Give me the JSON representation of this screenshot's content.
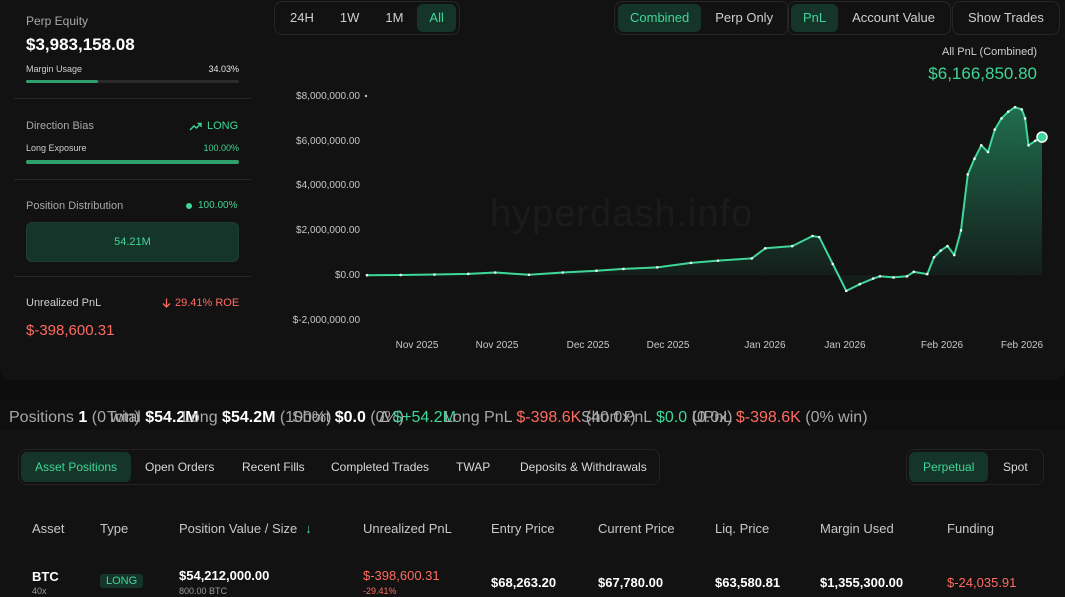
{
  "summary": {
    "perp_equity_label": "Perp Equity",
    "perp_equity_value": "$3,983,158.08",
    "margin_usage_label": "Margin Usage",
    "margin_usage_value": "34.03%",
    "margin_usage_fraction": 0.3403,
    "direction_bias_label": "Direction Bias",
    "direction_bias_value": "LONG",
    "long_exposure_label": "Long Exposure",
    "long_exposure_value": "100.00%",
    "long_exposure_fraction": 1.0,
    "position_distribution_label": "Position Distribution",
    "position_distribution_value": "100.00%",
    "distribution_bar_value": "54.21M",
    "unrealized_pnl_label": "Unrealized PnL",
    "unrealized_pnl_roe": "29.41% ROE",
    "unrealized_pnl_value": "$-398,600.31"
  },
  "range_buttons": [
    "24H",
    "1W",
    "1M",
    "All"
  ],
  "range_active": "All",
  "scope_buttons": [
    "Combined",
    "Perp Only"
  ],
  "metric_buttons": [
    "PnL",
    "Account Value"
  ],
  "show_trades_label": "Show Trades",
  "chart_header": {
    "label": "All PnL (Combined)",
    "value": "$6,166,850.80"
  },
  "watermark": "hyperdash.info",
  "chart_data": {
    "type": "area",
    "title": "All PnL (Combined)",
    "y_ticks": [
      "$8,000,000.00",
      "$6,000,000.00",
      "$4,000,000.00",
      "$2,000,000.00",
      "$0.00",
      "$-2,000,000.00"
    ],
    "y_tick_values": [
      8000000,
      6000000,
      4000000,
      2000000,
      0,
      -2000000
    ],
    "x_ticks": [
      "Nov 2025",
      "Nov 2025",
      "Dec 2025",
      "Dec 2025",
      "Jan 2026",
      "Jan 2026",
      "Feb 2026",
      "Feb 2026"
    ],
    "x_range": [
      0,
      100
    ],
    "ylim": [
      -2000000,
      8000000
    ],
    "series": [
      {
        "color": "#3fd699",
        "x": [
          0,
          5,
          10,
          15,
          19,
          24,
          29,
          34,
          38,
          43,
          48,
          52,
          57,
          59,
          63,
          66,
          67,
          69,
          71,
          73,
          75,
          76,
          78,
          80,
          81,
          83,
          84,
          85,
          86,
          87,
          88,
          89,
          90,
          91,
          92,
          93,
          94,
          95,
          96,
          97,
          97.5,
          98,
          99,
          100
        ],
        "y": [
          0,
          10000,
          30000,
          60000,
          120000,
          20000,
          120000,
          200000,
          280000,
          350000,
          550000,
          650000,
          750000,
          1200000,
          1300000,
          1750000,
          1700000,
          500000,
          -700000,
          -400000,
          -150000,
          -50000,
          -100000,
          -50000,
          150000,
          50000,
          800000,
          1100000,
          1300000,
          900000,
          2000000,
          4500000,
          5200000,
          5800000,
          5500000,
          6500000,
          7000000,
          7300000,
          7500000,
          7400000,
          7000000,
          5800000,
          6000000,
          6166850.8
        ]
      }
    ],
    "grid": false,
    "legend": "none"
  },
  "stats_strip": {
    "positions_label": "Positions",
    "positions_value": "1",
    "positions_sub": "(0 win)",
    "total_label": "Total",
    "total_value": "$54.2M",
    "long_label": "Long",
    "long_value": "$54.2M",
    "long_sub": "(100%)",
    "short_label": "Short",
    "short_value": "$0.0",
    "short_sub": "(0%)",
    "delta_label": "Δ",
    "delta_value": "$+54.2M",
    "long_pnl_label": "Long PnL",
    "long_pnl_value": "$-398.6K",
    "long_pnl_sub": "(40.0x)",
    "short_pnl_label": "Short PnL",
    "short_pnl_value": "$0.0",
    "short_pnl_sub": "(0.0x)",
    "upnl_label": "UPnL",
    "upnl_value": "$-398.6K",
    "upnl_sub": "(0% win)"
  },
  "tabs": [
    "Asset Positions",
    "Open Orders",
    "Recent Fills",
    "Completed Trades",
    "TWAP",
    "Deposits & Withdrawals"
  ],
  "market_toggle": [
    "Perpetual",
    "Spot"
  ],
  "table": {
    "headers": [
      "Asset",
      "Type",
      "Position Value / Size",
      "Unrealized PnL",
      "Entry Price",
      "Current Price",
      "Liq. Price",
      "Margin Used",
      "Funding"
    ],
    "sort_arrow": "↓",
    "rows": [
      {
        "asset": "BTC",
        "leverage": "40x",
        "type": "LONG",
        "position_value": "$54,212,000.00",
        "size": "800.00 BTC",
        "unrealized_pnl": "$-398,600.31",
        "unrealized_pnl_pct": "-29.41%",
        "entry_price": "$68,263.20",
        "current_price": "$67,780.00",
        "liq_price": "$63,580.81",
        "margin_used": "$1,355,300.00",
        "funding": "$-24,035.91"
      }
    ]
  },
  "colors": {
    "accent": "#3fd699",
    "negative": "#ff6b61",
    "background": "#0d0d0d",
    "card": "#121212"
  }
}
